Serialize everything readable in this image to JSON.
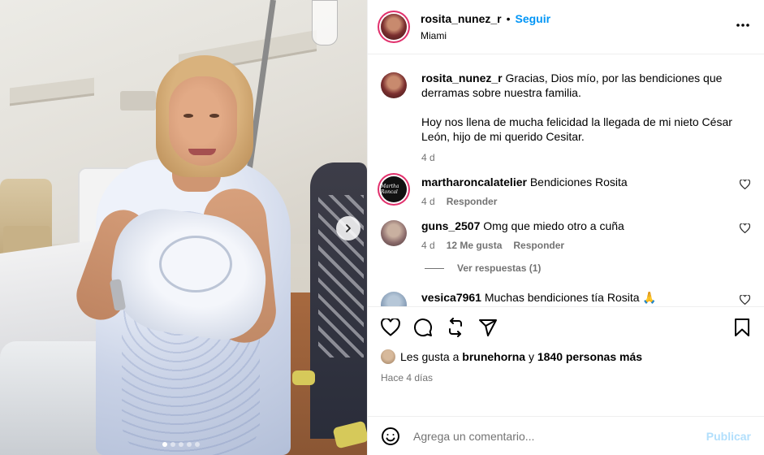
{
  "post": {
    "username": "rosita_nunez_r",
    "separator": "•",
    "follow_label": "Seguir",
    "location": "Miami",
    "more_label": "•••"
  },
  "caption": {
    "username": "rosita_nunez_r",
    "line1": "Gracias, Dios mío, por las bendiciones que derramas sobre nuestra familia.",
    "line2": "Hoy nos llena de mucha felicidad la llegada de mi nieto César León, hijo de mi querido Cesitar.",
    "age": "4 d"
  },
  "comments": [
    {
      "username": "martharoncalatelier",
      "text": "Bendiciones Rosita",
      "age": "4 d",
      "likes": "",
      "reply_label": "Responder",
      "avatar_text": "Martha Roncal"
    },
    {
      "username": "guns_2507",
      "text": "Omg que miedo otro a cuña",
      "age": "4 d",
      "likes": "12 Me gusta",
      "reply_label": "Responder"
    },
    {
      "username": "vesica7961",
      "text": "Muchas bendiciones tía Rosita 🙏"
    }
  ],
  "view_replies": "Ver respuestas (1)",
  "likes": {
    "prefix": "Les gusta a",
    "user": "brunehorna",
    "connector": "y",
    "others": "1840 personas más"
  },
  "posted_time": "Hace 4 días",
  "add_comment": {
    "placeholder": "Agrega un comentario...",
    "publish_label": "Publicar"
  },
  "carousel": {
    "slides": 5,
    "active": 1
  },
  "colors": {
    "accent": "#0095f6",
    "publish_disabled": "#b2dffc",
    "muted": "#737373",
    "story_ring": "#e1306c"
  }
}
